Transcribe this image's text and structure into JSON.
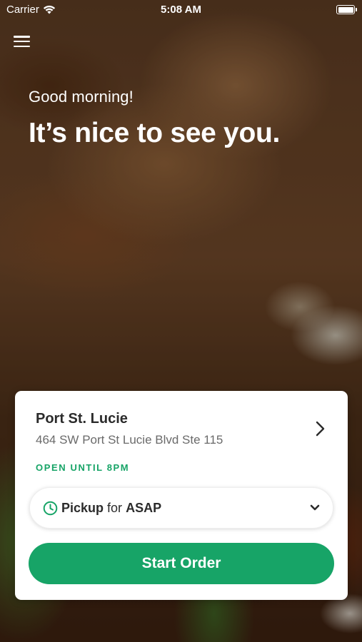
{
  "status_bar": {
    "carrier": "Carrier",
    "time": "5:08 AM",
    "icons": [
      "wifi-icon",
      "battery-icon"
    ]
  },
  "header": {
    "menu_icon": "hamburger-menu-icon",
    "greeting": "Good morning!",
    "headline": "It’s nice to see you."
  },
  "store": {
    "name": "Port St. Lucie",
    "address": "464 SW Port St Lucie Blvd Ste 115",
    "status": "OPEN UNTIL 8PM"
  },
  "order_mode": {
    "mode": "Pickup",
    "connector": "for",
    "time": "ASAP"
  },
  "actions": {
    "start_order": "Start Order"
  },
  "colors": {
    "accent": "#17a467",
    "text_primary": "#2b2b2b",
    "text_secondary": "#6a6a6a"
  }
}
